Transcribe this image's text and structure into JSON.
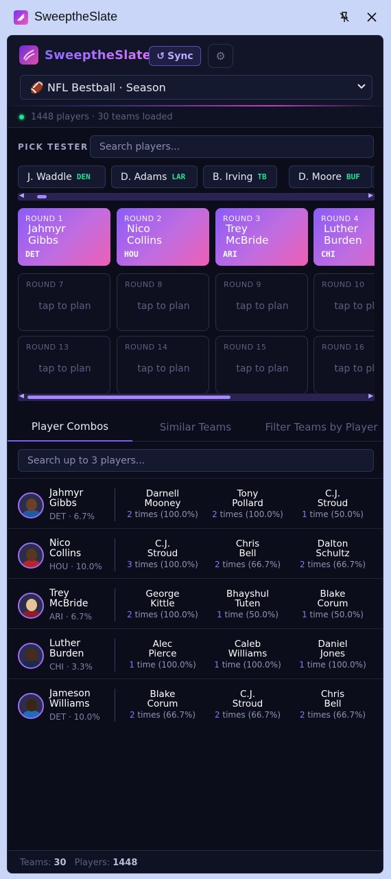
{
  "window": {
    "title": "SweeptheSlate"
  },
  "header": {
    "brand": "SweeptheSlate",
    "sync_label": "Sync",
    "league": "🏈 NFL Bestball · Season"
  },
  "status": {
    "text": "1448 players · 30 teams loaded",
    "color": "#22e28c"
  },
  "pick_tester": {
    "label": "PICK TESTER",
    "placeholder": "Search players...",
    "chips": [
      {
        "name": "J. Waddle",
        "team": "DEN"
      },
      {
        "name": "D. Adams",
        "team": "LAR"
      },
      {
        "name": "B. Irving",
        "team": "TB"
      },
      {
        "name": "D. Moore",
        "team": "BUF"
      }
    ],
    "top_scroll_fraction": 0.03,
    "board": [
      {
        "round": "ROUND 1",
        "name": "Jahmyr\nGibbs",
        "team": "DET"
      },
      {
        "round": "ROUND 2",
        "name": "Nico\nCollins",
        "team": "HOU"
      },
      {
        "round": "ROUND 3",
        "name": "Trey\nMcBride",
        "team": "ARI"
      },
      {
        "round": "ROUND 4",
        "name": "Luther\nBurden",
        "team": "CHI"
      },
      {
        "round": "ROUND 7",
        "plan": "tap to plan"
      },
      {
        "round": "ROUND 8",
        "plan": "tap to plan"
      },
      {
        "round": "ROUND 9",
        "plan": "tap to plan"
      },
      {
        "round": "ROUND 10",
        "plan": "tap to plan"
      },
      {
        "round": "ROUND 13",
        "plan": "tap to plan"
      },
      {
        "round": "ROUND 14",
        "plan": "tap to plan"
      },
      {
        "round": "ROUND 15",
        "plan": "tap to plan"
      },
      {
        "round": "ROUND 16",
        "plan": "tap to plan"
      }
    ]
  },
  "tabs": [
    "Player Combos",
    "Similar Teams",
    "Filter Teams by Player"
  ],
  "combos": {
    "placeholder": "Search up to 3 players...",
    "rows": [
      {
        "player": "Jahmyr\nGibbs",
        "meta": "DET · 6.7%",
        "mates": [
          {
            "name": "Darnell\nMooney",
            "count": "2",
            "suffix": " times (100.0%)"
          },
          {
            "name": "Tony\nPollard",
            "count": "2",
            "suffix": " times (100.0%)"
          },
          {
            "name": "C.J.\nStroud",
            "count": "1",
            "suffix": " time (50.0%)"
          }
        ]
      },
      {
        "player": "Nico\nCollins",
        "meta": "HOU · 10.0%",
        "mates": [
          {
            "name": "C.J.\nStroud",
            "count": "3",
            "suffix": " times (100.0%)"
          },
          {
            "name": "Chris\nBell",
            "count": "2",
            "suffix": " times (66.7%)"
          },
          {
            "name": "Dalton\nSchultz",
            "count": "2",
            "suffix": " times (66.7%)"
          }
        ]
      },
      {
        "player": "Trey\nMcBride",
        "meta": "ARI · 6.7%",
        "mates": [
          {
            "name": "George\nKittle",
            "count": "2",
            "suffix": " times (100.0%)"
          },
          {
            "name": "Bhayshul\nTuten",
            "count": "1",
            "suffix": " time (50.0%)"
          },
          {
            "name": "Blake\nCorum",
            "count": "1",
            "suffix": " time (50.0%)"
          }
        ]
      },
      {
        "player": "Luther\nBurden",
        "meta": "CHI · 3.3%",
        "mates": [
          {
            "name": "Alec\nPierce",
            "count": "1",
            "suffix": " time (100.0%)"
          },
          {
            "name": "Caleb\nWilliams",
            "count": "1",
            "suffix": " time (100.0%)"
          },
          {
            "name": "Daniel\nJones",
            "count": "1",
            "suffix": " time (100.0%)"
          }
        ]
      },
      {
        "player": "Jameson\nWilliams",
        "meta": "DET · 10.0%",
        "mates": [
          {
            "name": "Blake\nCorum",
            "count": "2",
            "suffix": " times (66.7%)"
          },
          {
            "name": "C.J.\nStroud",
            "count": "2",
            "suffix": " times (66.7%)"
          },
          {
            "name": "Chris\nBell",
            "count": "2",
            "suffix": " times (66.7%)"
          }
        ]
      }
    ]
  },
  "footer": {
    "teams_label": "Teams:",
    "teams": "30",
    "players_label": "Players:",
    "players": "1448"
  }
}
